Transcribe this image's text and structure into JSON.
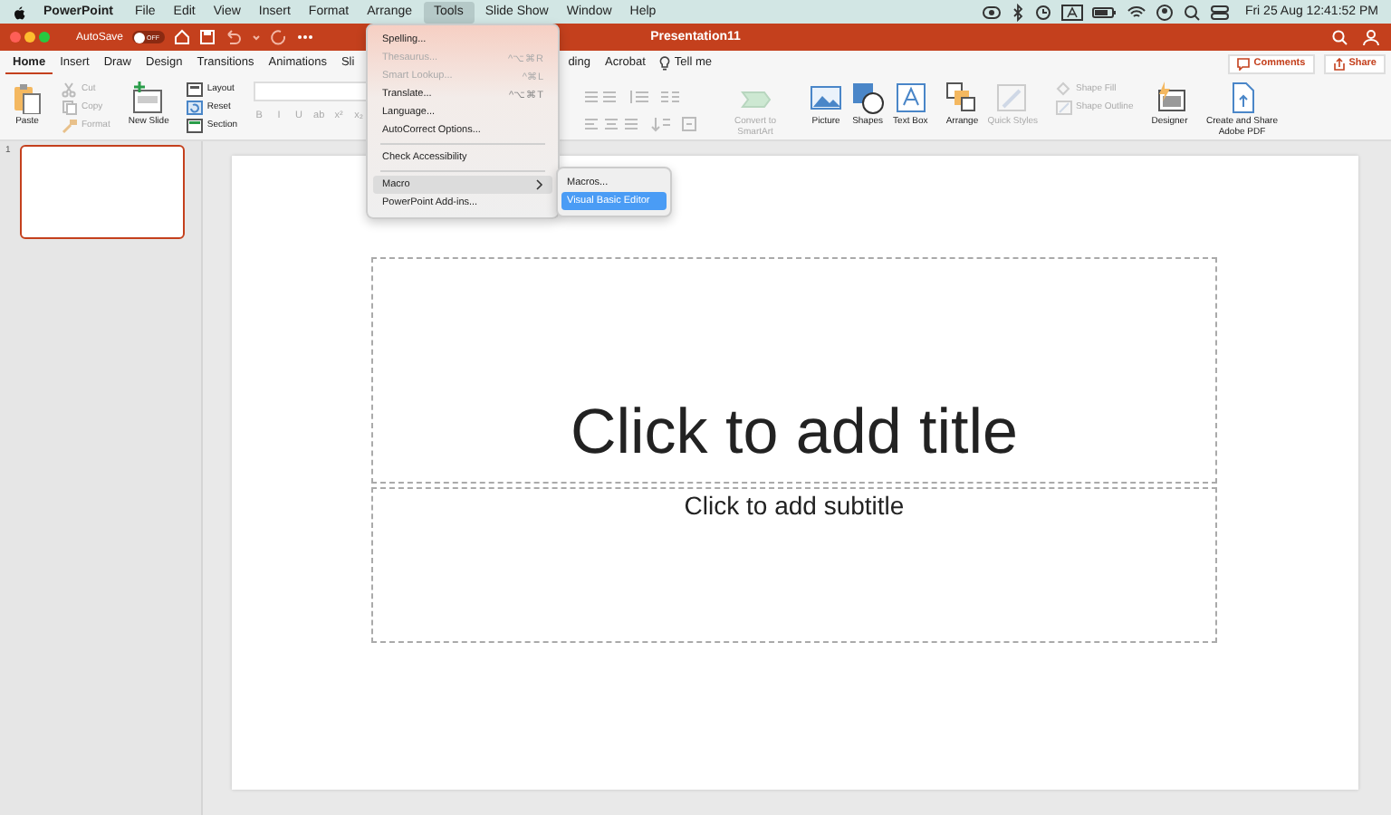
{
  "menu_bar": {
    "app": "PowerPoint",
    "items": [
      {
        "label": "File",
        "selected": false
      },
      {
        "label": "Edit",
        "selected": false
      },
      {
        "label": "View",
        "selected": false
      },
      {
        "label": "Insert",
        "selected": false
      },
      {
        "label": "Format",
        "selected": false
      },
      {
        "label": "Arrange",
        "selected": false
      },
      {
        "label": "Tools",
        "selected": true
      },
      {
        "label": "Slide Show",
        "selected": false
      },
      {
        "label": "Window",
        "selected": false
      },
      {
        "label": "Help",
        "selected": false
      }
    ],
    "clock": "Fri 25 Aug  12:41:52 PM"
  },
  "window": {
    "title": "Presentation11",
    "autosave": {
      "label": "AutoSave",
      "on": false,
      "state_text": "OFF"
    }
  },
  "ribbon": {
    "tabs": [
      {
        "label": "Home",
        "selected": true
      },
      {
        "label": "Insert",
        "selected": false
      },
      {
        "label": "Draw",
        "selected": false
      },
      {
        "label": "Design",
        "selected": false
      },
      {
        "label": "Transitions",
        "selected": false
      },
      {
        "label": "Animations",
        "selected": false
      },
      {
        "label": "Sli",
        "selected": false
      },
      {
        "label": "ding",
        "selected": false
      },
      {
        "label": "Acrobat",
        "selected": false
      },
      {
        "label": "Tell me",
        "selected": false
      }
    ],
    "buttons": [
      {
        "label": "Comments"
      },
      {
        "label": "Share"
      }
    ],
    "columns": [
      {
        "kind": "large",
        "items": [
          {
            "label": "Paste",
            "disabled": false
          }
        ]
      },
      {
        "kind": "small",
        "items": [
          {
            "label": "Cut",
            "disabled": true
          },
          {
            "label": "Copy",
            "disabled": true
          },
          {
            "label": "Format",
            "disabled": true
          }
        ]
      },
      {
        "kind": "large",
        "items": [
          {
            "label": "New Slide",
            "disabled": false
          }
        ]
      },
      {
        "kind": "small",
        "items": [
          {
            "label": "Layout",
            "disabled": false
          },
          {
            "label": "Reset",
            "disabled": false
          },
          {
            "label": "Section",
            "disabled": false
          }
        ]
      },
      {
        "kind": "font",
        "items": [
          {
            "label": "B",
            "disabled": true
          },
          {
            "label": "I",
            "disabled": true
          },
          {
            "label": "U",
            "disabled": true
          },
          {
            "label": "ab",
            "disabled": true
          },
          {
            "label": "x²",
            "disabled": true
          },
          {
            "label": "x₂",
            "disabled": true
          }
        ]
      },
      {
        "kind": "gap"
      },
      {
        "kind": "paragraph"
      },
      {
        "kind": "large",
        "items": [
          {
            "label": "Convert to SmartArt",
            "disabled": true
          }
        ]
      },
      {
        "kind": "large",
        "items": [
          {
            "label": "Picture",
            "disabled": false
          },
          {
            "label": "Shapes",
            "disabled": false
          },
          {
            "label": "Text Box",
            "disabled": false
          }
        ]
      },
      {
        "kind": "large",
        "items": [
          {
            "label": "Arrange",
            "disabled": false
          },
          {
            "label": "Quick Styles",
            "disabled": true
          }
        ]
      },
      {
        "kind": "small",
        "items": [
          {
            "label": "Shape Fill",
            "disabled": true
          },
          {
            "label": "Shape Outline",
            "disabled": true
          }
        ]
      },
      {
        "kind": "large",
        "items": [
          {
            "label": "Designer",
            "disabled": false
          }
        ]
      },
      {
        "kind": "large",
        "items": [
          {
            "label": "Create and Share Adobe PDF",
            "disabled": false
          }
        ]
      }
    ]
  },
  "slides": [
    {
      "number": "1",
      "selected": true
    }
  ],
  "slide": {
    "title_placeholder": "Click to add title",
    "subtitle_placeholder": "Click to add subtitle"
  },
  "tools_menu": {
    "items": [
      {
        "label": "Spelling...",
        "disabled": false,
        "selected": false
      },
      {
        "label": "Thesaurus...",
        "shortcut": "^⌥⌘R",
        "disabled": true,
        "selected": false
      },
      {
        "label": "Smart Lookup...",
        "shortcut": "^⌘L",
        "disabled": true,
        "selected": false
      },
      {
        "label": "Translate...",
        "shortcut": "^⌥⌘T",
        "disabled": false,
        "selected": false
      },
      {
        "label": "Language...",
        "disabled": false,
        "selected": false
      },
      {
        "label": "AutoCorrect Options...",
        "disabled": false,
        "selected": false
      },
      {
        "kind": "separator"
      },
      {
        "label": "Check Accessibility",
        "disabled": false,
        "selected": false
      },
      {
        "kind": "separator"
      },
      {
        "label": "Macro",
        "disabled": false,
        "selected": true,
        "submenu": true
      },
      {
        "label": "PowerPoint Add-ins...",
        "disabled": false,
        "selected": false
      }
    ]
  },
  "macro_submenu": {
    "items": [
      {
        "label": "Macros...",
        "selected": false
      },
      {
        "label": "Visual Basic Editor",
        "selected": true
      }
    ]
  }
}
